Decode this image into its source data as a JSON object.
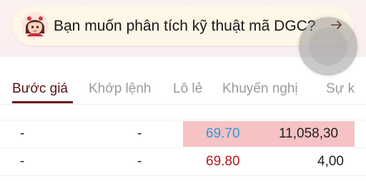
{
  "assistant": {
    "prompt": "Bạn muốn phân tích kỹ thuật mã DGC?"
  },
  "tabs": [
    {
      "label": "Bước giá",
      "active": true
    },
    {
      "label": "Khớp lệnh",
      "active": false
    },
    {
      "label": "Lô lẻ",
      "active": false
    },
    {
      "label": "Khuyến nghị",
      "active": false
    },
    {
      "label": "Sự k",
      "active": false
    }
  ],
  "rows": [
    {
      "col1": "-",
      "col2": "-",
      "price": "69.70",
      "volume": "11,058,30",
      "price_color": "#2f9ad6",
      "highlighted": true
    },
    {
      "col1": "-",
      "col2": "-",
      "price": "69.80",
      "volume": "4,00",
      "price_color": "#c0141c",
      "highlighted": false
    }
  ],
  "colors": {
    "accent": "#6b0f17",
    "highlight": "#f6c2c4"
  },
  "icons": {
    "avatar": "assistant-avatar-icon",
    "arrow": "arrow-right-icon"
  }
}
